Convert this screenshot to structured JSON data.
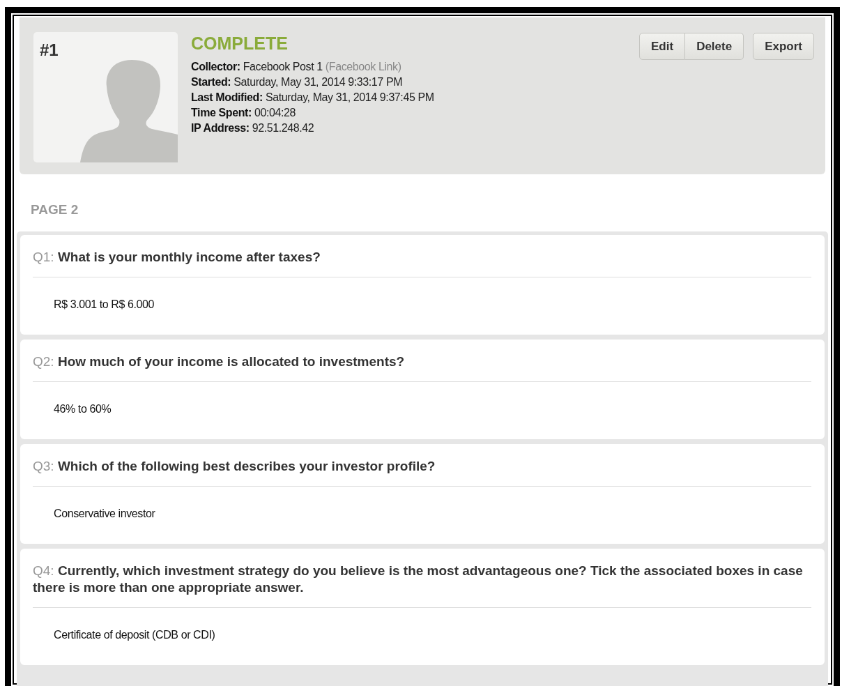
{
  "response": {
    "number": "#1",
    "status": "COMPLETE",
    "collector": {
      "label": "Collector:",
      "value": "Facebook Post 1",
      "link": "(Facebook Link)"
    },
    "details": [
      {
        "label": "Started:",
        "value": "Saturday, May 31, 2014 9:33:17 PM"
      },
      {
        "label": "Last Modified:",
        "value": "Saturday, May 31, 2014 9:37:45 PM"
      },
      {
        "label": "Time Spent:",
        "value": "00:04:28"
      },
      {
        "label": "IP Address:",
        "value": "92.51.248.42"
      }
    ],
    "button_group": [
      "Edit",
      "Delete"
    ],
    "export_button": "Export"
  },
  "page_title": "PAGE 2",
  "questions": [
    {
      "number": "Q1:",
      "text": "What is your monthly income after taxes?",
      "answer": "R$ 3.001 to R$ 6.000"
    },
    {
      "number": "Q2:",
      "text": "How much of your income is allocated to investments?",
      "answer": "46% to 60%"
    },
    {
      "number": "Q3:",
      "text": "Which of the following best describes your investor profile?",
      "answer": "Conservative investor"
    },
    {
      "number": "Q4:",
      "text": "Currently, which investment strategy do you believe is the most advantageous one? Tick the associated boxes in case there is more than one appropriate answer.",
      "answer": "Certificate of deposit (CDB or CDI)"
    }
  ]
}
